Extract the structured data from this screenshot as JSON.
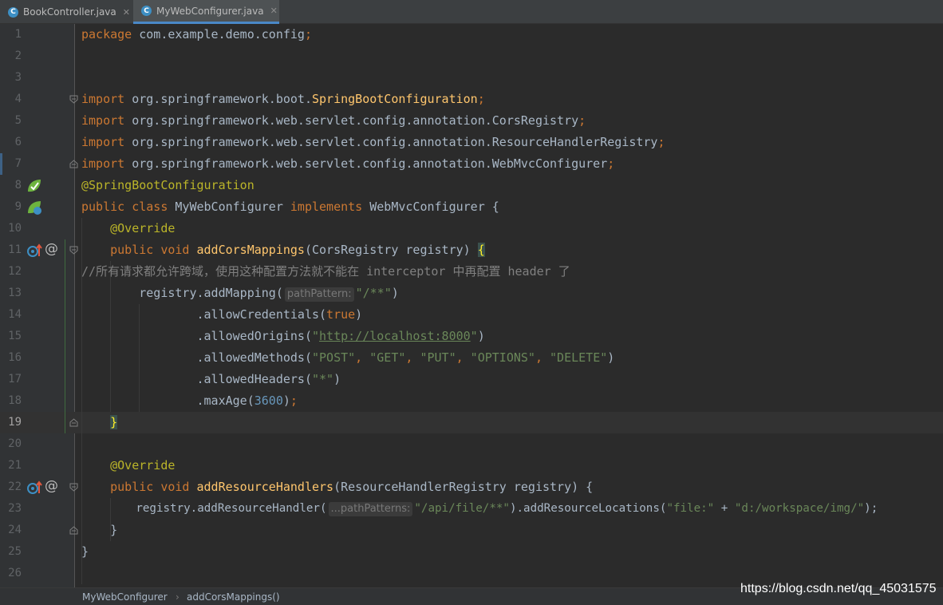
{
  "tabs": [
    {
      "label": "BookController.java",
      "icon": "java-class-icon"
    },
    {
      "label": "MyWebConfigurer.java",
      "icon": "java-class-icon",
      "active": true
    }
  ],
  "line_numbers": [
    "1",
    "2",
    "3",
    "4",
    "5",
    "6",
    "7",
    "8",
    "9",
    "10",
    "11",
    "12",
    "13",
    "14",
    "15",
    "16",
    "17",
    "18",
    "19",
    "20",
    "21",
    "22",
    "23",
    "24",
    "25",
    "26"
  ],
  "code": {
    "l1": [
      "package",
      " com.example.demo.config",
      ";"
    ],
    "l4": [
      "import",
      " org.springframework.boot.",
      "SpringBootConfiguration",
      ";"
    ],
    "l5": [
      "import",
      " org.springframework.web.servlet.config.annotation.CorsRegistry",
      ";"
    ],
    "l6": [
      "import",
      " org.springframework.web.servlet.config.annotation.ResourceHandlerRegistry",
      ";"
    ],
    "l7": [
      "import",
      " org.springframework.web.servlet.config.annotation.WebMvcConfigurer",
      ";"
    ],
    "l8": [
      "@SpringBootConfiguration"
    ],
    "l9": [
      "public class",
      " MyWebConfigurer ",
      "implements",
      " WebMvcConfigurer {"
    ],
    "l10": [
      "    ",
      "@Override"
    ],
    "l11": [
      "    ",
      "public void",
      " ",
      "addCorsMappings",
      "(CorsRegistry registry) ",
      "{"
    ],
    "l12": [
      "//所有请求都允许跨域，使用这种配置方法就不能在 interceptor 中再配置 header 了"
    ],
    "l13": [
      "        registry.addMapping(",
      "pathPattern:",
      "\"/**\"",
      ")"
    ],
    "l14": [
      "                .allowCredentials(",
      "true",
      ")"
    ],
    "l15": [
      "                .allowedOrigins(",
      "\"",
      "http://localhost:8000",
      "\"",
      ")"
    ],
    "l16": [
      "                .allowedMethods(",
      "\"POST\"",
      ", ",
      "\"GET\"",
      ", ",
      "\"PUT\"",
      ", ",
      "\"OPTIONS\"",
      ", ",
      "\"DELETE\"",
      ")"
    ],
    "l17": [
      "                .allowedHeaders(",
      "\"*\"",
      ")"
    ],
    "l18": [
      "                .maxAge(",
      "3600",
      ")",
      ";"
    ],
    "l19": [
      "    ",
      "}"
    ],
    "l21": [
      "    ",
      "@Override"
    ],
    "l22": [
      "    ",
      "public void",
      " ",
      "addResourceHandlers",
      "(ResourceHandlerRegistry registry) {"
    ],
    "l23": [
      "        registry.addResourceHandler(",
      "...pathPatterns:",
      "\"/api/file/**\"",
      ").addResourceLocations(",
      "\"file:\"",
      " + ",
      "\"d:/workspace/img/\"",
      ");"
    ],
    "l24": [
      "    }"
    ],
    "l25": [
      "}"
    ]
  },
  "breadcrumb": {
    "class": "MyWebConfigurer",
    "method": "addCorsMappings()",
    "separator": "›"
  },
  "watermark": "https://blog.csdn.net/qq_45031575",
  "colors": {
    "background": "#2b2b2b",
    "keyword": "#cc7832",
    "annotation": "#bbb529",
    "method": "#ffc66d",
    "string": "#6a8759",
    "number": "#6897bb",
    "comment": "#808080",
    "text": "#a9b7c6"
  }
}
